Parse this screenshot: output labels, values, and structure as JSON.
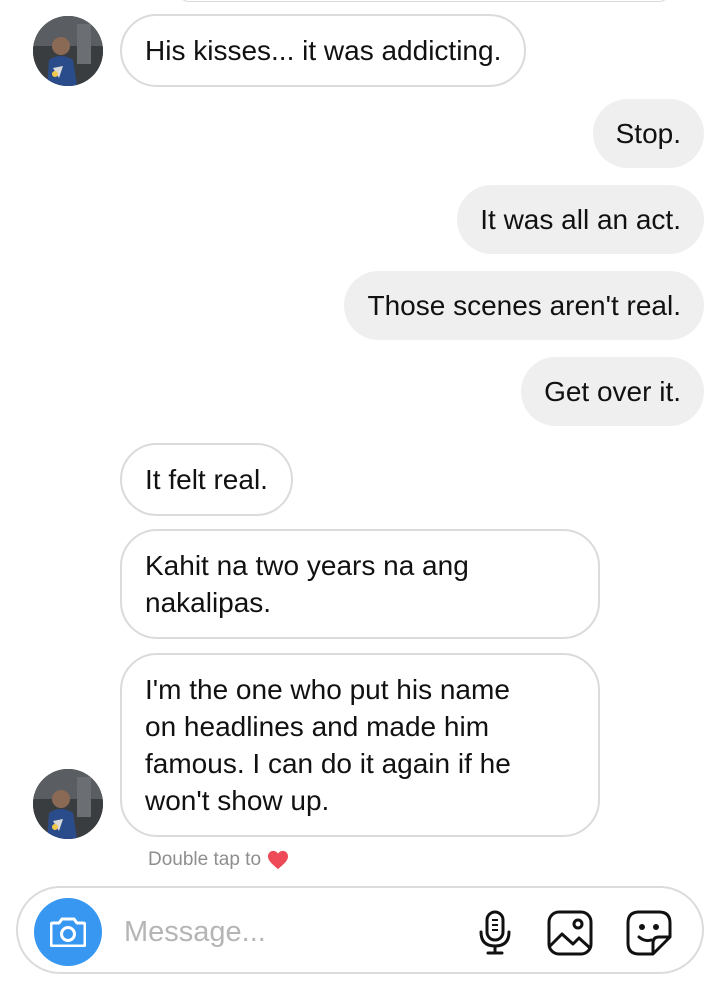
{
  "thread": {
    "messages": [
      {
        "id": 1,
        "direction": "in",
        "text": "His kisses... it was addicting."
      },
      {
        "id": 2,
        "direction": "out",
        "text": "Stop."
      },
      {
        "id": 3,
        "direction": "out",
        "text": "It was all an act."
      },
      {
        "id": 4,
        "direction": "out",
        "text": "Those scenes aren't real."
      },
      {
        "id": 5,
        "direction": "out",
        "text": "Get over it."
      },
      {
        "id": 6,
        "direction": "in",
        "text": "It felt real."
      },
      {
        "id": 7,
        "direction": "in",
        "text": "Kahit na two years na ang\nnakalipas."
      },
      {
        "id": 8,
        "direction": "in",
        "text": "I'm the one who put his name\non headlines and made him\nfamous. I can do it again if he\nwon't show up."
      }
    ],
    "reaction_hint": {
      "text": "Double tap to",
      "icon": "heart-icon",
      "color": "#ed4956"
    }
  },
  "composer": {
    "placeholder": "Message...",
    "camera_icon": "camera-icon",
    "accent": "#3897f0",
    "tools": [
      "microphone-icon",
      "gallery-icon",
      "sticker-icon"
    ]
  }
}
